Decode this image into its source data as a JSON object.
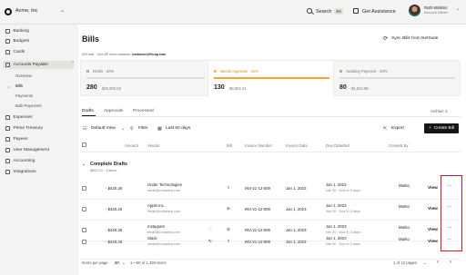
{
  "org": {
    "name": "Acme, Inc"
  },
  "topbar": {
    "search_label": "Search",
    "search_shortcut": "⌘K",
    "assist_label": "Get Assistance",
    "user_name": "Ruth Watkins",
    "user_role": "Account Owner"
  },
  "sidebar": {
    "items": [
      {
        "label": "Banking"
      },
      {
        "label": "Budgets"
      },
      {
        "label": "Cards"
      },
      {
        "label": "Accounts Payable"
      },
      {
        "label": "Overview"
      },
      {
        "label": "Bills"
      },
      {
        "label": "Payments"
      },
      {
        "label": "Bulk Payments"
      },
      {
        "label": "Expenses"
      },
      {
        "label": "Prime Treasury"
      },
      {
        "label": "Payees"
      },
      {
        "label": "User Management"
      },
      {
        "label": "Accounting"
      },
      {
        "label": "Integrations"
      }
    ]
  },
  "page": {
    "title": "Bills",
    "sync_label": "Sync Bills from NetSuite",
    "info_prefix": "500 bills · Your AP Inbox address:",
    "info_email": "customer@fin.ap.com"
  },
  "summary": [
    {
      "label": "Drafts · 50%",
      "count": "280",
      "amount": "$20,000.02",
      "color": "#bdbdbd"
    },
    {
      "label": "Needs Approval · 15%",
      "count": "130",
      "amount": "$6,802.21",
      "color": "#f0a433"
    },
    {
      "label": "Awaiting Payment · 20%",
      "count": "80",
      "amount": "$1,622.88",
      "color": "#6fb36a"
    }
  ],
  "tabs": [
    {
      "label": "Drafts"
    },
    {
      "label": "Approvals"
    },
    {
      "label": "Processed"
    }
  ],
  "archive_label": "Archive: 4",
  "toolbar": {
    "view_label": "Default View",
    "filter_label": "Filter",
    "range_label": "Last 60 days",
    "export_label": "Export",
    "create_label": "Create Bill"
  },
  "columns": {
    "amount": "Amount",
    "vendor": "Vendor",
    "bill": "Bill",
    "invoice_number": "Invoice Number",
    "invoice_date": "Invoice Date",
    "due_date": "Due Date/Net",
    "created_by": "Created By"
  },
  "group": {
    "title": "Complete Drafts",
    "subtitle": "$800.23 · 4 items"
  },
  "rows": [
    {
      "amount": "- $420.26",
      "vendor": "Under Technologies",
      "email": "email@company.com",
      "invoice": "INV-21-12-009",
      "inv_date": "Jan 1, 2023",
      "due": "Jan 1, 2023",
      "net": "Net 30 · Due in 5 days",
      "creator": "Marko",
      "view": "View",
      "more": "···"
    },
    {
      "amount": "- $420.26",
      "vendor": "Apple Inc.",
      "email": "email@company.com",
      "invoice": "INV-21-12-009",
      "inv_date": "Jan 1, 2023",
      "due": "Jan 1, 2023",
      "net": "Net 30 · Due in 5 days",
      "creator": "Marko",
      "view": "View",
      "more": "···"
    },
    {
      "amount": "- $420.26",
      "vendor": "Instagram",
      "email": "email@company.com",
      "invoice": "INV-21-12-009",
      "inv_date": "Jan 1, 2023",
      "due": "Jan 1, 2023",
      "net": "Net 30 · Due in 5 days",
      "creator": "Marko",
      "view": "View",
      "more": "···"
    },
    {
      "amount": "- $420.26",
      "vendor": "Slack",
      "email": "email@company.com",
      "invoice": "INV-21-12-009",
      "inv_date": "Jan 1, 2023",
      "due": "Jan 1, 2023",
      "net": "Net 30 · Due in 5 days",
      "creator": "Marko",
      "view": "View",
      "more": "···"
    }
  ],
  "footer": {
    "per_page_label": "Items per page",
    "per_page_value": "50",
    "range_text": "1—50 of 1,393 items",
    "pages_text": "1 of 12 pages"
  }
}
